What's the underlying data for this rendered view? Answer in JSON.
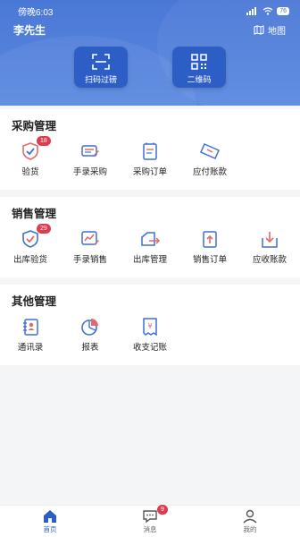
{
  "status": {
    "time": "傍晚6:03",
    "signal": "4G",
    "battery": "76"
  },
  "header": {
    "user_name": "李先生",
    "map_label": "地图"
  },
  "quick_actions": [
    {
      "label": "扫码过磅",
      "icon": "scan-icon"
    },
    {
      "label": "二维码",
      "icon": "qr-code-icon"
    }
  ],
  "purchase": {
    "title": "采购管理",
    "items": [
      {
        "label": "验货",
        "icon": "shield-check-icon",
        "badge": "18"
      },
      {
        "label": "手录采购",
        "icon": "printer-icon"
      },
      {
        "label": "采购订单",
        "icon": "document-icon"
      },
      {
        "label": "应付账款",
        "icon": "ticket-icon"
      }
    ]
  },
  "sales": {
    "title": "销售管理",
    "items": [
      {
        "label": "出库验货",
        "icon": "shield-check-icon",
        "badge": "29"
      },
      {
        "label": "手录销售",
        "icon": "chart-edit-icon"
      },
      {
        "label": "出库管理",
        "icon": "outbound-icon"
      },
      {
        "label": "销售订单",
        "icon": "order-up-icon"
      },
      {
        "label": "应收账款",
        "icon": "inbox-down-icon"
      }
    ]
  },
  "other": {
    "title": "其他管理",
    "items": [
      {
        "label": "通讯录",
        "icon": "contacts-icon"
      },
      {
        "label": "报表",
        "icon": "pie-chart-icon"
      },
      {
        "label": "收支记账",
        "icon": "receipt-icon"
      }
    ]
  },
  "tabbar": [
    {
      "label": "首页",
      "icon": "home-icon",
      "active": true
    },
    {
      "label": "消息",
      "icon": "message-icon",
      "badge": "9"
    },
    {
      "label": "我的",
      "icon": "user-icon"
    }
  ],
  "colors": {
    "primary": "#2c5ec6",
    "header": "#4a78d6",
    "badge": "#e03a4f",
    "icon_red": "#e2686f",
    "icon_blue": "#3f6fd8"
  }
}
